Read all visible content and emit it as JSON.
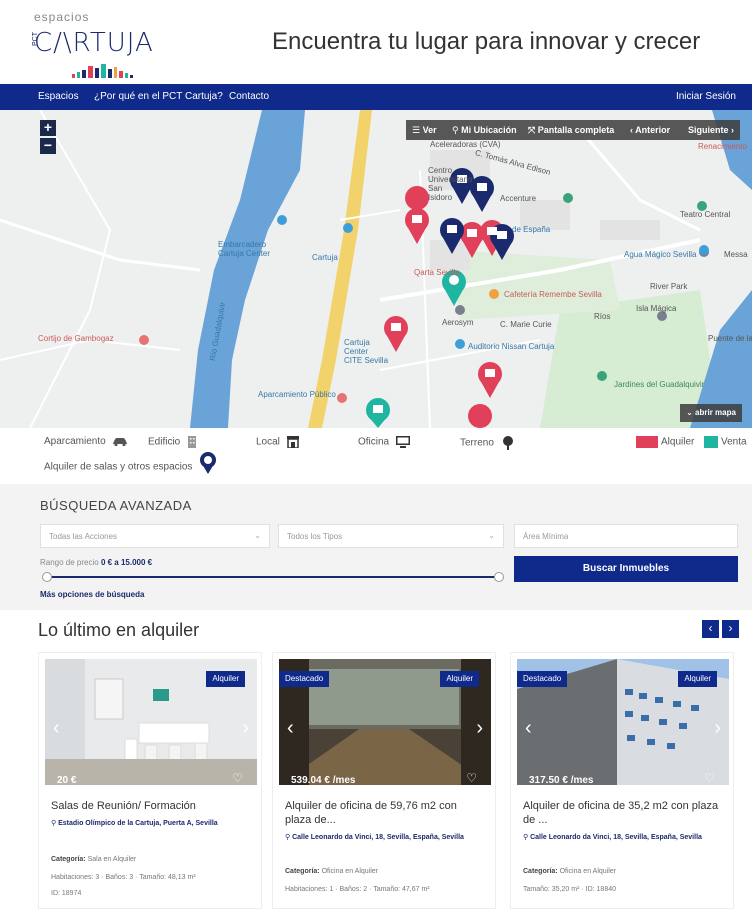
{
  "header": {
    "logo_small": "espacios",
    "logo_main": "C/\\RTUJA",
    "logo_vertical": "PCT",
    "tagline": "Encuentra tu lugar para innovar y crecer"
  },
  "nav": {
    "items": [
      "Espacios",
      "¿Por qué en el PCT Cartuja?",
      "Contacto"
    ],
    "login": "Iniciar Sesión"
  },
  "map": {
    "zoom_in": "+",
    "zoom_out": "−",
    "toolbar": {
      "view": "Ver",
      "location": "Mi Ubicación",
      "fullscreen": "Pantalla completa",
      "prev": "Anterior",
      "next": "Siguiente"
    },
    "open_map": "abrir mapa",
    "labels": {
      "l1": "Aceleradoras (CVA)",
      "l2": "Embarcadero Cartuja Center",
      "l3": "Cartuja",
      "l4": "de España",
      "l5": "Agua Mágico Sevilla",
      "l6": "Teatro Central",
      "l7": "Isla Mágica",
      "l8": "River Park",
      "l9": "Cafetería Remembe Sevilla",
      "l10": "Auditorio Nissan Cartuja",
      "l11": "Cortijo de Gambogaz",
      "l12": "Jardines del Guadalquivir",
      "l13": "Aparcamiento Público",
      "l14": "Cartuja Center CITE Sevilla",
      "l15": "Renacimiento",
      "l16": "Puente de la",
      "l17": "Río Guadalquivir",
      "l18": "Centro Universitario San Isidoro",
      "l19": "Accenture",
      "l20": "Qarta Sevilla",
      "l21": "Aerosym",
      "l22": "C. Marie Curie",
      "l23": "Messa",
      "l24": "Ríos",
      "l25": "C. Tomás Alva Edison"
    }
  },
  "legend": {
    "aparcamiento": "Aparcamiento",
    "edificio": "Edificio",
    "local": "Local",
    "oficina": "Oficina",
    "terreno": "Terreno",
    "alquiler": "Alquiler",
    "venta": "Venta",
    "salas": "Alquiler de salas y otros espacios"
  },
  "search": {
    "title": "BÚSQUEDA AVANZADA",
    "select_actions": "Todas las Acciones",
    "select_types": "Todos los Tipos",
    "area_placeholder": "Área Mínima",
    "price_label": "Rango de precio",
    "price_range": "0 € a 15.000 €",
    "button": "Buscar Inmuebles",
    "more_options": "Más opciones de búsqueda"
  },
  "latest": {
    "title": "Lo último en alquiler",
    "prev": "‹",
    "next": "›"
  },
  "cards": [
    {
      "badge_right": "Alquiler",
      "badge_left": "",
      "price": "20 €",
      "title": "Salas de Reunión/ Formación",
      "location": "Estadio Olímpico de la Cartuja, Puerta A, Sevilla",
      "category_label": "Categoría:",
      "category": "Sala en Alquiler",
      "line2": "Habitaciones: 3 · Baños: 3 · Tamaño: 48,13 m²",
      "line3": "ID: 18974"
    },
    {
      "badge_right": "Alquiler",
      "badge_left": "Destacado",
      "price": "539.04 € /mes",
      "title": "Alquiler de oficina de 59,76 m2 con plaza de...",
      "location": "Calle Leonardo da Vinci, 18, Sevilla, España, Sevilla",
      "category_label": "Categoría:",
      "category": "Oficina en Alquiler",
      "line2": "Habitaciones: 1 · Baños: 2 · Tamaño: 47,67 m²",
      "line3": ""
    },
    {
      "badge_right": "Alquiler",
      "badge_left": "Destacado",
      "price": "317.50 € /mes",
      "title": "Alquiler de oficina de 35,2 m2 con plaza de ...",
      "location": "Calle Leonardo da Vinci, 18, Sevilla, España, Sevilla",
      "category_label": "Categoría:",
      "category": "Oficina en Alquiler",
      "line2": "Tamaño: 35,20 m² · ID: 18840",
      "line3": ""
    }
  ],
  "colors": {
    "brand": "#0f2a8a",
    "alquiler": "#e0405a",
    "venta": "#1fb5a0"
  }
}
